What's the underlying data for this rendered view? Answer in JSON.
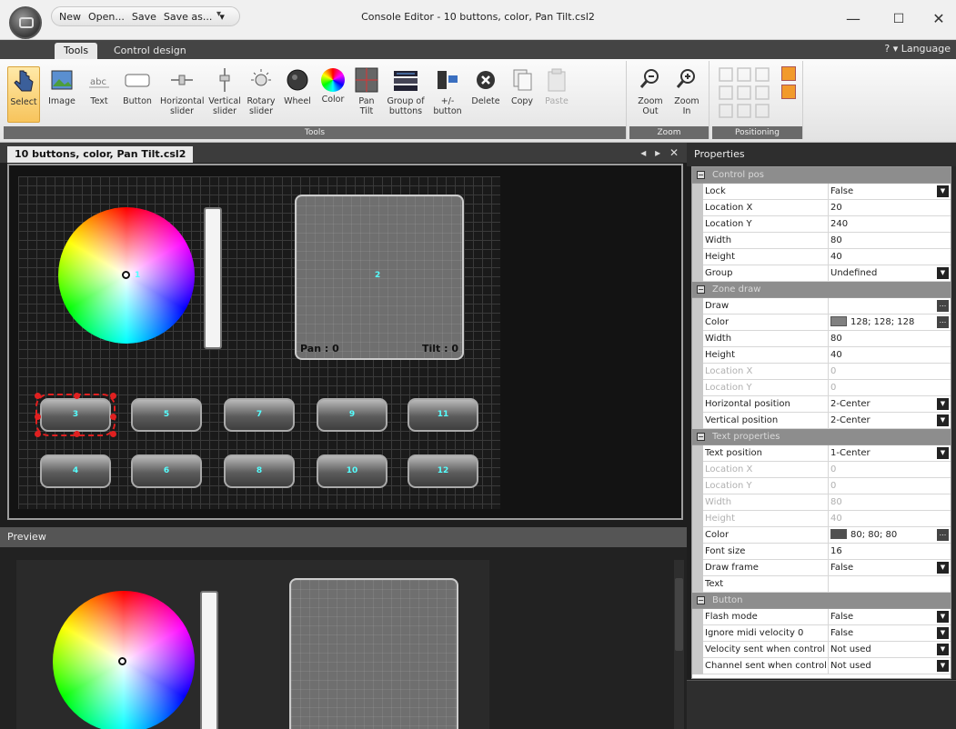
{
  "window": {
    "title": "Console Editor - 10 buttons, color, Pan Tilt.csl2",
    "minimize": "—",
    "maximize": "☐",
    "close": "✕"
  },
  "quick_access": [
    "New",
    "Open...",
    "Save",
    "Save as...",
    "▾"
  ],
  "quick_access_more": "▾",
  "ribbon_tabs": [
    {
      "label": "Tools",
      "active": true
    },
    {
      "label": "Control design",
      "active": false
    }
  ],
  "language_menu": "? ▾ Language",
  "ribbon": {
    "tools_group": {
      "label": "Tools",
      "buttons": [
        {
          "label": "Select",
          "icon": "hand-pointer-icon",
          "selected": true
        },
        {
          "label": "Image",
          "icon": "image-icon"
        },
        {
          "label": "Text",
          "icon": "text-icon"
        },
        {
          "label": "Button",
          "icon": "button-icon"
        },
        {
          "label": "Horizontal slider",
          "icon": "horizontal-slider-icon"
        },
        {
          "label": "Vertical slider",
          "icon": "vertical-slider-icon"
        },
        {
          "label": "Rotary slider",
          "icon": "rotary-slider-icon"
        },
        {
          "label": "Wheel",
          "icon": "wheel-icon"
        },
        {
          "label": "Color",
          "icon": "color-wheel-icon"
        },
        {
          "label": "Pan Tilt",
          "icon": "pan-tilt-icon"
        },
        {
          "label": "Group of buttons",
          "icon": "group-buttons-icon"
        },
        {
          "label": "+/- button",
          "icon": "plus-minus-button-icon"
        },
        {
          "label": "Delete",
          "icon": "delete-icon"
        },
        {
          "label": "Copy",
          "icon": "copy-icon"
        },
        {
          "label": "Paste",
          "icon": "paste-icon",
          "disabled": true
        }
      ]
    },
    "zoom_group": {
      "label": "Zoom",
      "buttons": [
        {
          "label": "Zoom Out",
          "icon": "zoom-out-icon"
        },
        {
          "label": "Zoom In",
          "icon": "zoom-in-icon"
        }
      ]
    },
    "positioning_group": {
      "label": "Positioning"
    }
  },
  "document_tab": {
    "label": "10 buttons, color, Pan Tilt.csl2",
    "nav": "◂ ▸ ✕"
  },
  "design": {
    "color_wheel_index": "1",
    "pantilt": {
      "index": "2",
      "pan_label": "Pan : 0",
      "tilt_label": "Tilt : 0"
    },
    "buttons_row1": [
      "3",
      "5",
      "7",
      "9",
      "11"
    ],
    "buttons_row2": [
      "4",
      "6",
      "8",
      "10",
      "12"
    ]
  },
  "preview": {
    "title": "Preview"
  },
  "properties": {
    "title": "Properties",
    "categories": [
      {
        "name": "Control pos",
        "rows": [
          {
            "name": "Lock",
            "value": "False",
            "dropdown": true
          },
          {
            "name": "Location X",
            "value": "20"
          },
          {
            "name": "Location Y",
            "value": "240"
          },
          {
            "name": "Width",
            "value": "80"
          },
          {
            "name": "Height",
            "value": "40"
          },
          {
            "name": "Group",
            "value": "Undefined",
            "dropdown": true
          }
        ]
      },
      {
        "name": "Zone draw",
        "rows": [
          {
            "name": "Draw",
            "value": "",
            "ellipsis": true
          },
          {
            "name": "Color",
            "value": "128; 128; 128",
            "swatch": "#808080",
            "ellipsis": true
          },
          {
            "name": "Width",
            "value": "80"
          },
          {
            "name": "Height",
            "value": "40"
          },
          {
            "name": "Location X",
            "value": "0",
            "disabled": true
          },
          {
            "name": "Location Y",
            "value": "0",
            "disabled": true
          },
          {
            "name": "Horizontal position",
            "value": "2-Center",
            "dropdown": true
          },
          {
            "name": "Vertical position",
            "value": "2-Center",
            "dropdown": true
          }
        ]
      },
      {
        "name": "Text properties",
        "rows": [
          {
            "name": "Text position",
            "value": "1-Center",
            "dropdown": true
          },
          {
            "name": "Location X",
            "value": "0",
            "disabled": true
          },
          {
            "name": "Location Y",
            "value": "0",
            "disabled": true
          },
          {
            "name": "Width",
            "value": "80",
            "disabled": true
          },
          {
            "name": "Height",
            "value": "40",
            "disabled": true
          },
          {
            "name": "Color",
            "value": "80; 80; 80",
            "swatch": "#505050",
            "ellipsis": true
          },
          {
            "name": "Font size",
            "value": "16"
          },
          {
            "name": "Draw frame",
            "value": "False",
            "dropdown": true
          },
          {
            "name": "Text",
            "value": ""
          }
        ]
      },
      {
        "name": "Button",
        "rows": [
          {
            "name": "Flash mode",
            "value": "False",
            "dropdown": true
          },
          {
            "name": "Ignore midi velocity 0",
            "value": "False",
            "dropdown": true
          },
          {
            "name": "Velocity sent when control",
            "value": "Not used",
            "dropdown": true
          },
          {
            "name": "Channel sent when control",
            "value": "Not used",
            "dropdown": true
          }
        ]
      }
    ]
  }
}
